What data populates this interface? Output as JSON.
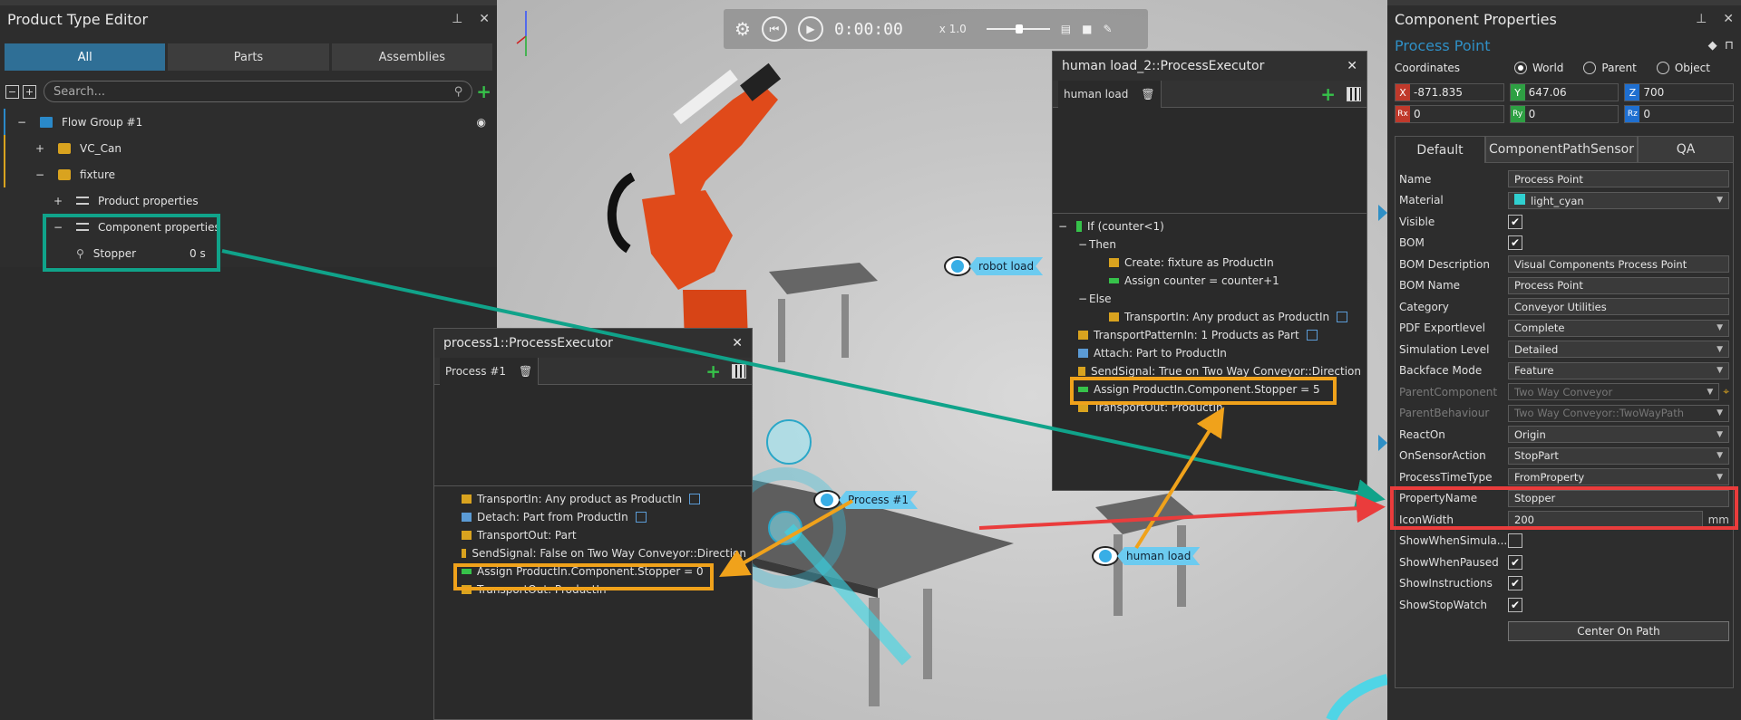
{
  "left_panel": {
    "title": "Product Type Editor",
    "tabs": [
      "All",
      "Parts",
      "Assemblies"
    ],
    "search_placeholder": "Search...",
    "tree": {
      "flow_group": "Flow Group #1",
      "vc_can": "VC_Can",
      "fixture": "fixture",
      "product_properties": "Product properties",
      "component_properties": "Component properties",
      "stopper": "Stopper",
      "stopper_value": "0 s"
    }
  },
  "sim_toolbar": {
    "time": "0:00:00",
    "speed": "x 1.0"
  },
  "viewport_tags": {
    "robot_load": "robot load",
    "process1": "Process #1",
    "human_load": "human load"
  },
  "exec_human": {
    "title": "human load_2::ProcessExecutor",
    "tab": "human load",
    "statements": [
      "If (counter<1)",
      "Then",
      "Create: fixture as ProductIn",
      "Assign counter = counter+1",
      "Else",
      "TransportIn: Any product as ProductIn",
      "TransportPatternIn: 1 Products as Part",
      "Attach: Part to ProductIn",
      "SendSignal: True on Two Way Conveyor::Direction",
      "Assign ProductIn.Component.Stopper = 5",
      "TransportOut: ProductIn"
    ]
  },
  "exec_process1": {
    "title": "process1::ProcessExecutor",
    "tab": "Process #1",
    "statements": [
      "TransportIn: Any product as ProductIn",
      "Detach: Part from ProductIn",
      "TransportOut: Part",
      "SendSignal: False on Two Way Conveyor::Direction",
      "Assign ProductIn.Component.Stopper = 0",
      "TransportOut: ProductIn"
    ]
  },
  "right_panel": {
    "title": "Component Properties",
    "subtitle": "Process Point",
    "coordinates_label": "Coordinates",
    "coord_modes": [
      "World",
      "Parent",
      "Object"
    ],
    "x": "-871.835",
    "y": "647.06",
    "z": "700",
    "rx": "0",
    "ry": "0",
    "rz": "0",
    "axis_labels": {
      "x": "X",
      "y": "Y",
      "z": "Z",
      "rx": "Rx",
      "ry": "Ry",
      "rz": "Rz"
    },
    "tabs": [
      "Default",
      "ComponentPathSensor",
      "QA"
    ],
    "props": {
      "name_k": "Name",
      "name_v": "Process Point",
      "material_k": "Material",
      "material_v": "light_cyan",
      "visible_k": "Visible",
      "bom_k": "BOM",
      "bomdesc_k": "BOM Description",
      "bomdesc_v": "Visual Components Process Point",
      "bomname_k": "BOM Name",
      "bomname_v": "Process Point",
      "category_k": "Category",
      "category_v": "Conveyor Utilities",
      "pdf_k": "PDF Exportlevel",
      "pdf_v": "Complete",
      "simlevel_k": "Simulation Level",
      "simlevel_v": "Detailed",
      "backface_k": "Backface Mode",
      "backface_v": "Feature",
      "parentcomp_k": "ParentComponent",
      "parentcomp_v": "Two Way Conveyor",
      "parentbeh_k": "ParentBehaviour",
      "parentbeh_v": "Two Way Conveyor::TwoWayPath",
      "reacton_k": "ReactOn",
      "reacton_v": "Origin",
      "onsensor_k": "OnSensorAction",
      "onsensor_v": "StopPart",
      "ptt_k": "ProcessTimeType",
      "ptt_v": "FromProperty",
      "pname_k": "PropertyName",
      "pname_v": "Stopper",
      "iconw_k": "IconWidth",
      "iconw_v": "200",
      "iconw_unit": "mm",
      "showsim_k": "ShowWhenSimula...",
      "showpaused_k": "ShowWhenPaused",
      "showinstr_k": "ShowInstructions",
      "showstop_k": "ShowStopWatch",
      "center_btn": "Center On Path"
    }
  },
  "colors": {
    "accent_blue": "#2f6f96",
    "highlight_green": "#10a38a",
    "highlight_orange": "#f0a21b",
    "highlight_red": "#ea3c3c"
  }
}
